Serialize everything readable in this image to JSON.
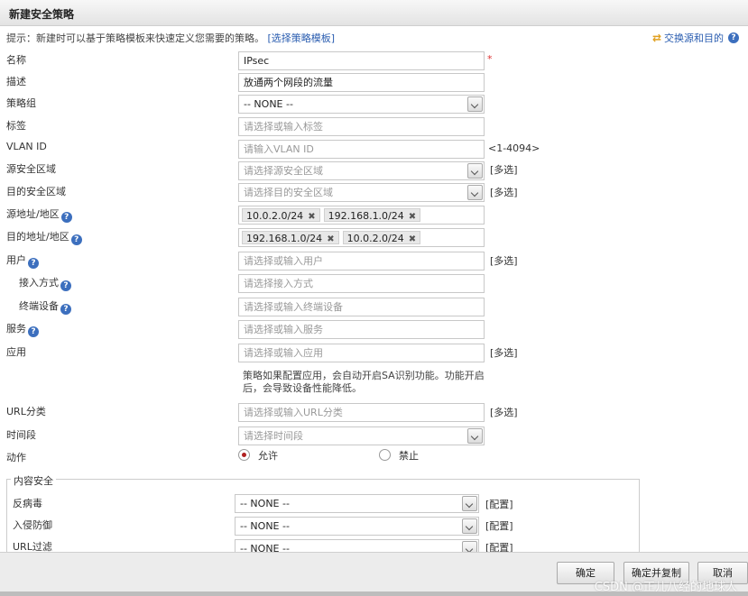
{
  "dialog": {
    "title": "新建安全策略"
  },
  "hint": {
    "text": "提示：新建时可以基于策略模板来快速定义您需要的策略。",
    "link": "[选择策略模板]"
  },
  "swap": {
    "label": "交换源和目的"
  },
  "help_glyph": "?",
  "fields": {
    "name": {
      "label": "名称",
      "value": "IPsec",
      "required_mark": "*"
    },
    "desc": {
      "label": "描述",
      "value": "放通两个网段的流量"
    },
    "group": {
      "label": "策略组",
      "value": "-- NONE --"
    },
    "tag": {
      "label": "标签",
      "placeholder": "请选择或输入标签"
    },
    "vlan": {
      "label": "VLAN ID",
      "placeholder": "请输入VLAN ID",
      "range": "<1-4094>"
    },
    "src_zone": {
      "label": "源安全区域",
      "placeholder": "请选择源安全区域",
      "multi": "[多选]"
    },
    "dst_zone": {
      "label": "目的安全区域",
      "placeholder": "请选择目的安全区域",
      "multi": "[多选]"
    },
    "src_addr": {
      "label": "源地址/地区",
      "tags": [
        "10.0.2.0/24",
        "192.168.1.0/24"
      ]
    },
    "dst_addr": {
      "label": "目的地址/地区",
      "tags": [
        "192.168.1.0/24",
        "10.0.2.0/24"
      ]
    },
    "user": {
      "label": "用户",
      "placeholder": "请选择或输入用户",
      "multi": "[多选]"
    },
    "access": {
      "label": "接入方式",
      "placeholder": "请选择接入方式"
    },
    "device": {
      "label": "终端设备",
      "placeholder": "请选择或输入终端设备"
    },
    "service": {
      "label": "服务",
      "placeholder": "请选择或输入服务"
    },
    "app": {
      "label": "应用",
      "placeholder": "请选择或输入应用",
      "multi": "[多选]",
      "note": "策略如果配置应用，会自动开启SA识别功能。功能开启后，会导致设备性能降低。"
    },
    "url_cat": {
      "label": "URL分类",
      "placeholder": "请选择或输入URL分类",
      "multi": "[多选]"
    },
    "time": {
      "label": "时间段",
      "placeholder": "请选择时间段"
    },
    "action": {
      "label": "动作",
      "allow": "允许",
      "deny": "禁止",
      "selected": "allow"
    }
  },
  "content_security": {
    "legend": "内容安全",
    "rows": [
      {
        "label": "反病毒",
        "value": "-- NONE --",
        "config": "[配置]"
      },
      {
        "label": "入侵防御",
        "value": "-- NONE --",
        "config": "[配置]"
      },
      {
        "label": "URL过滤",
        "value": "-- NONE --",
        "config": "[配置]"
      }
    ]
  },
  "buttons": {
    "ok": "确定",
    "ok_copy": "确定并复制",
    "cancel": "取消"
  },
  "watermark": "CSDN @正儿八经的地球人",
  "tag_remove_glyph": "✖"
}
